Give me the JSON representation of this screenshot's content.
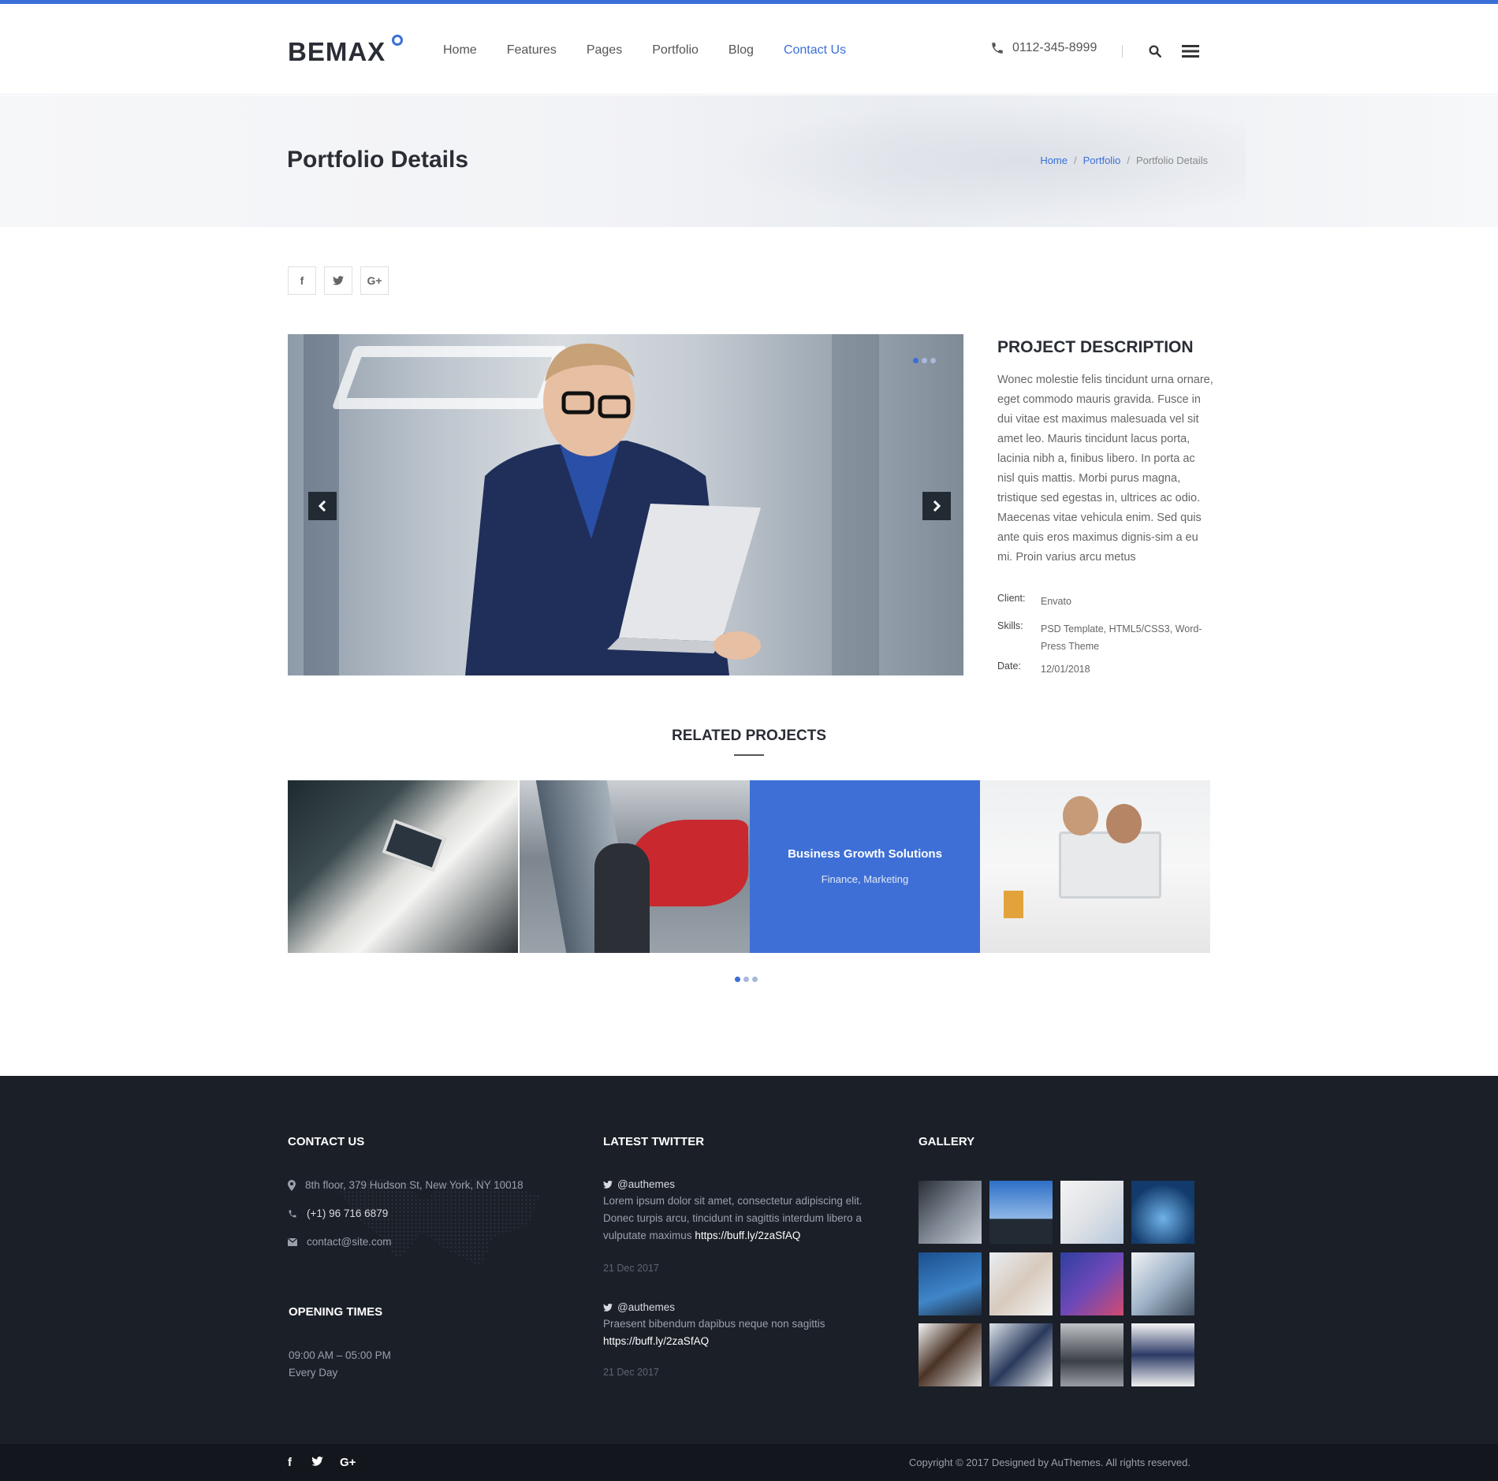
{
  "brand": {
    "logo": "BEMAX",
    "accent": "#3a6fd8"
  },
  "nav": {
    "items": [
      {
        "label": "Home"
      },
      {
        "label": "Features"
      },
      {
        "label": "Pages"
      },
      {
        "label": "Portfolio"
      },
      {
        "label": "Blog"
      },
      {
        "label": "Contact Us",
        "active": true
      }
    ],
    "phone": "0112-345-8999",
    "icons": [
      "phone-icon",
      "search-icon",
      "menu-icon"
    ]
  },
  "banner": {
    "title": "Portfolio Details",
    "breadcrumb": [
      "Home",
      "Portfolio",
      "Portfolio Details"
    ],
    "separator": "/"
  },
  "share": {
    "icons": [
      "facebook-icon",
      "twitter-icon",
      "google-plus-icon"
    ],
    "labels": [
      "f",
      "t",
      "G+"
    ]
  },
  "project": {
    "heading": "PROJECT DESCRIPTION",
    "description": "Wonec molestie felis tincidunt urna ornare, eget commodo mauris gravida. Fusce in dui vitae est maximus malesuada vel sit amet leo. Mauris tincidunt lacus porta, lacinia nibh a, finibus libero. In porta ac nisl quis mattis. Morbi purus magna, tristique sed egestas in, ultrices ac odio. Maecenas vitae vehicula enim. Sed quis ante quis eros maximus dignis-sim a eu mi. Proin varius arcu metus",
    "meta": [
      {
        "key": "Client:",
        "value": "Envato"
      },
      {
        "key": "Skills:",
        "value": "PSD Template, HTML5/CSS3, Word-Press Theme"
      },
      {
        "key": "Date:",
        "value": "12/01/2018"
      }
    ],
    "slider": {
      "dots": 3,
      "active_dot": 0
    }
  },
  "related": {
    "heading": "RELATED PROJECTS",
    "items": [
      {
        "title": "",
        "category": ""
      },
      {
        "title": "",
        "category": ""
      },
      {
        "title": "Business Growth Solutions",
        "category": "Finance, Marketing"
      },
      {
        "title": "",
        "category": ""
      }
    ],
    "dots": 3,
    "active_dot": 0
  },
  "footer": {
    "contact": {
      "heading": "CONTACT US",
      "address": "8th floor, 379 Hudson St, New York, NY 10018",
      "phone": "(+1) 96 716 6879",
      "email": "contact@site.com"
    },
    "opening": {
      "heading": "OPENING TIMES",
      "hours": "09:00 AM – 05:00 PM",
      "days": "Every Day"
    },
    "twitter": {
      "heading": "LATEST TWITTER",
      "tweets": [
        {
          "handle": "@authemes",
          "text": "Lorem ipsum dolor sit amet, consectetur adipiscing elit. Donec turpis arcu, tincidunt in sagittis interdum libero a vulputate maximus",
          "link": "https://buff.ly/2zaSfAQ",
          "date": "21 Dec 2017"
        },
        {
          "handle": "@authemes",
          "text": "Praesent bibendum dapibus neque non sagittis",
          "link": "https://buff.ly/2zaSfAQ",
          "date": "21 Dec 2017"
        }
      ]
    },
    "gallery": {
      "heading": "GALLERY",
      "count": 12
    },
    "bottom": {
      "social": [
        "f",
        "t",
        "G+"
      ],
      "copyright": "Copyright © 2017 Designed by AuThemes. All rights reserved."
    }
  }
}
